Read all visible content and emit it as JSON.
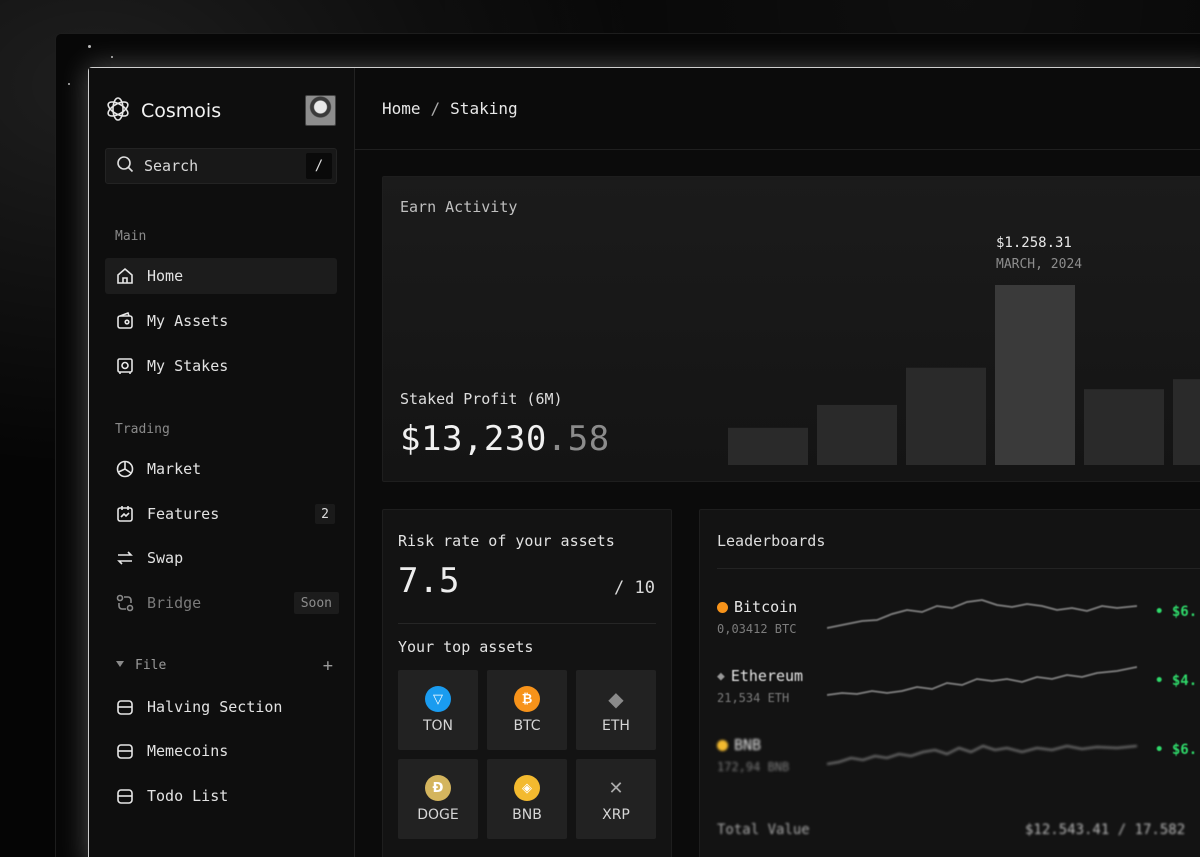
{
  "brand": {
    "name": "Cosmois"
  },
  "search": {
    "label": "Search",
    "shortcut": "/"
  },
  "sidebar": {
    "main_label": "Main",
    "main_items": [
      {
        "label": "Home",
        "icon": "home-icon",
        "active": true
      },
      {
        "label": "My Assets",
        "icon": "wallet-icon"
      },
      {
        "label": "My Stakes",
        "icon": "safe-icon"
      }
    ],
    "trading_label": "Trading",
    "trading_items": [
      {
        "label": "Market",
        "icon": "pie-chart-icon"
      },
      {
        "label": "Features",
        "icon": "calendar-icon",
        "badge": "2"
      },
      {
        "label": "Swap",
        "icon": "swap-icon"
      },
      {
        "label": "Bridge",
        "icon": "bridge-icon",
        "tag": "Soon",
        "disabled": true
      }
    ],
    "file_label": "File",
    "file_items": [
      {
        "label": "Halving Section",
        "icon": "folder-icon"
      },
      {
        "label": "Memecoins",
        "icon": "folder-icon"
      },
      {
        "label": "Todo List",
        "icon": "folder-icon"
      }
    ]
  },
  "breadcrumb": {
    "home": "Home",
    "separator": "/",
    "current": "Staking"
  },
  "earn": {
    "title": "Earn Activity",
    "profit_label": "Staked Profit (6M)",
    "profit_whole": "$13,230",
    "profit_decimal": ".58",
    "tooltip_value": "$1.258.31",
    "tooltip_date": "MARCH, 2024"
  },
  "chart_data": {
    "type": "bar",
    "title": "Earn Activity",
    "categories": [
      "",
      "",
      "",
      "MARCH, 2024",
      "",
      ""
    ],
    "values": [
      260,
      420,
      680,
      1258.31,
      530,
      600
    ],
    "highlight_index": 3
  },
  "risk": {
    "title": "Risk rate of your assets",
    "value": "7.5",
    "max": "/ 10",
    "top_assets_title": "Your top assets",
    "assets": [
      {
        "symbol": "TON",
        "color": "#1a9cf0",
        "glyph": "▽"
      },
      {
        "symbol": "BTC",
        "color": "#f7931a",
        "glyph": "₿"
      },
      {
        "symbol": "ETH",
        "color": "#3a3a3a",
        "glyph": "◆"
      },
      {
        "symbol": "DOGE",
        "color": "#d4b55e",
        "glyph": "Ð"
      },
      {
        "symbol": "BNB",
        "color": "#f3ba2f",
        "glyph": "◈"
      },
      {
        "symbol": "XRP",
        "color": "#3a3a3a",
        "glyph": "✕"
      }
    ]
  },
  "leaderboards": {
    "title": "Leaderboards",
    "rows": [
      {
        "name": "Bitcoin",
        "amount": "0,03412 BTC",
        "change": "• $6.",
        "dot_color": "#f7931a"
      },
      {
        "name": "Ethereum",
        "amount": "21,534 ETH",
        "change": "• $4.",
        "dot_color": "#888888"
      },
      {
        "name": "BNB",
        "amount": "172,94 BNB",
        "change": "• $6.",
        "dot_color": "#f3ba2f"
      }
    ],
    "total_label": "Total Value",
    "total_value": "$12.543.41 / 17.582"
  }
}
